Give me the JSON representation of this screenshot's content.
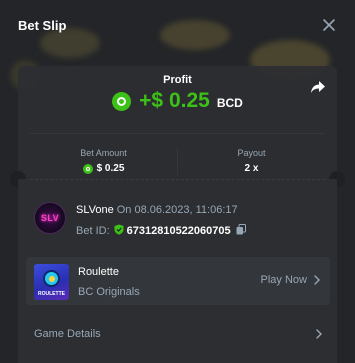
{
  "header": {
    "title": "Bet Slip"
  },
  "profit": {
    "label": "Profit",
    "value": "+$ 0.25",
    "currency": "BCD"
  },
  "stats": {
    "bet_amount_label": "Bet Amount",
    "bet_amount_value": "$ 0.25",
    "payout_label": "Payout",
    "payout_value": "2 x"
  },
  "user": {
    "avatar_text": "SLV",
    "name": "SLVone",
    "on_date": "On 08.06.2023, 11:06:17",
    "bet_id_label": "Bet ID:",
    "bet_id_value": "67312810522060705"
  },
  "game": {
    "thumb_text": "ROULETTE",
    "name": "Roulette",
    "provider": "BC Originals",
    "play_label": "Play Now"
  },
  "details": {
    "label": "Game Details"
  },
  "colors": {
    "accent_green": "#3bc117",
    "text_muted": "#98a7b5",
    "panel": "#2c2e32"
  }
}
